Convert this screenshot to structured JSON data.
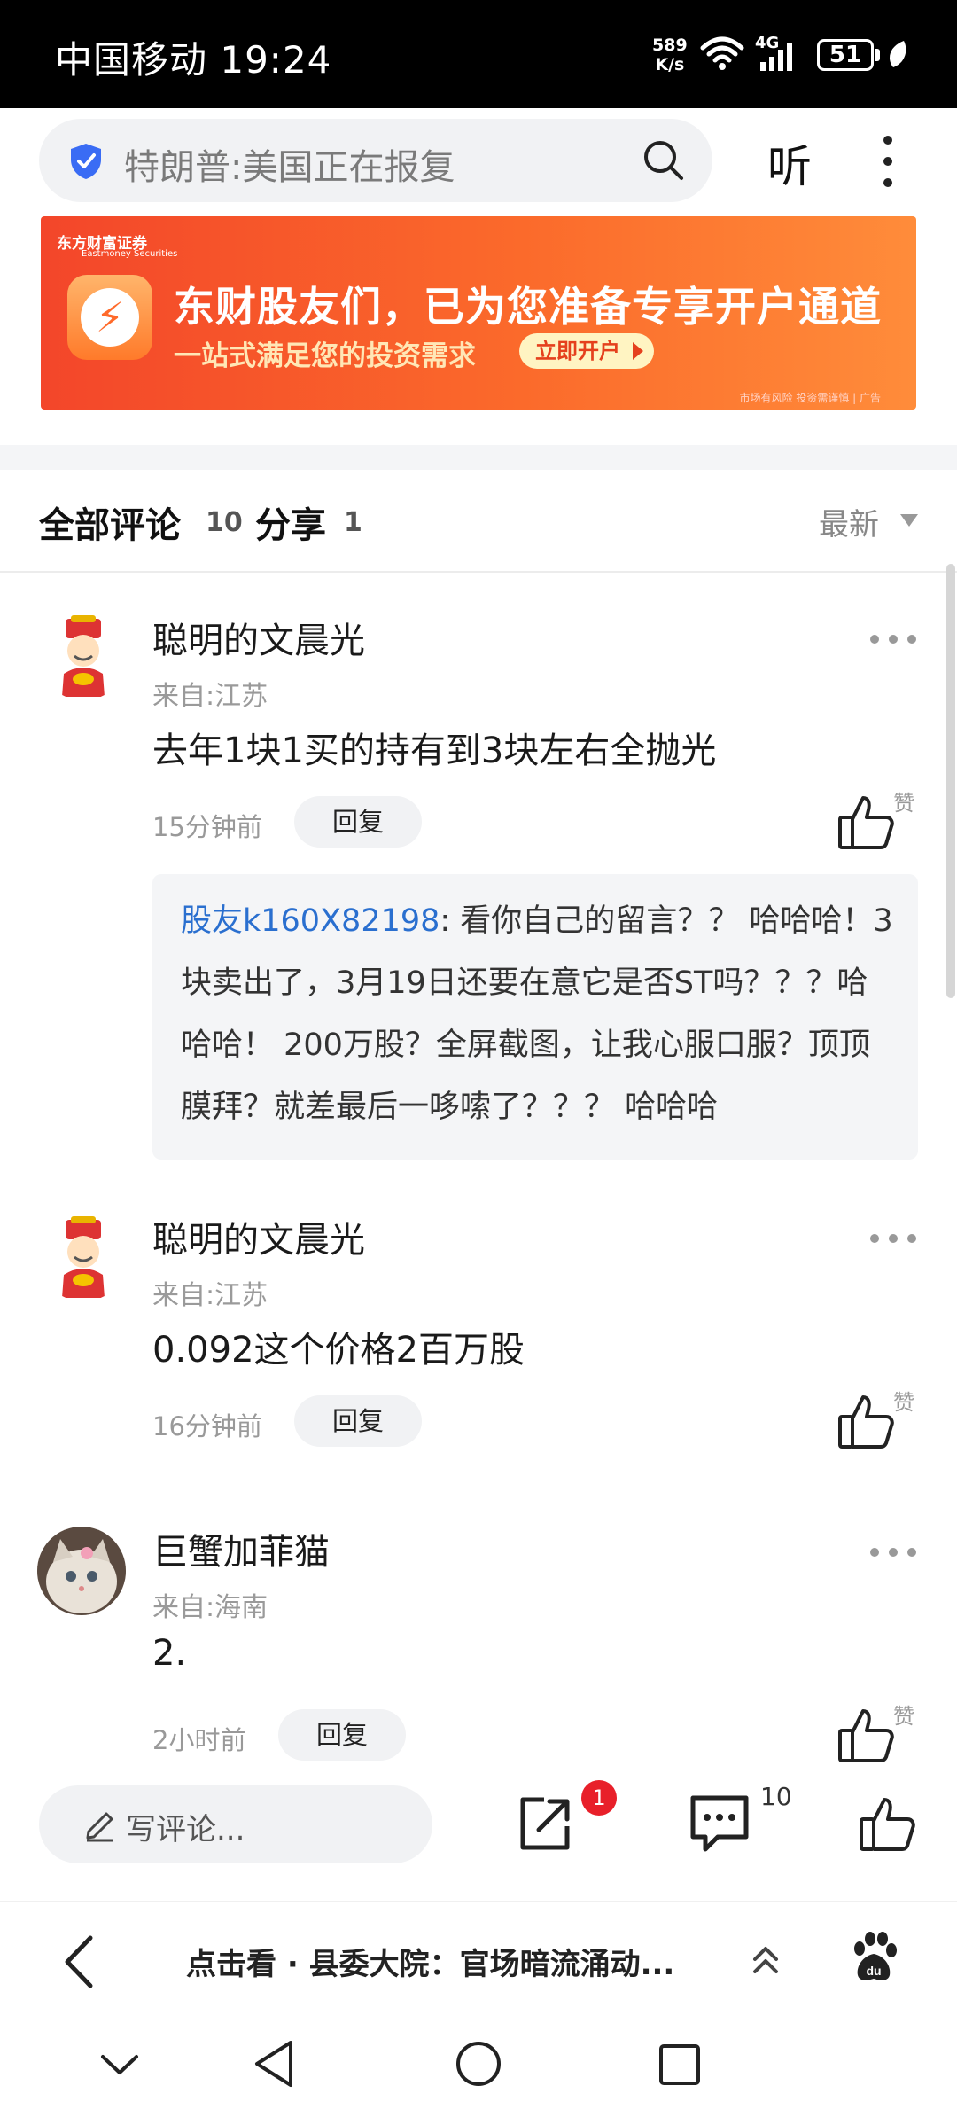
{
  "status_bar": {
    "carrier_time": "中国移动 19:24",
    "net_speed_value": "589",
    "net_speed_unit": "K/s",
    "network": "4G",
    "battery": "51"
  },
  "search": {
    "query": "特朗普:美国正在报复",
    "listen_label": "听"
  },
  "banner": {
    "brand": "东方财富证券",
    "brand_en": "Eastmoney Securities",
    "headline": "东财股友们，已为您准备专享开户通道",
    "subline": "一站式满足您的投资需求",
    "cta": "立即开户",
    "disclaimer": "市场有风险 投资需谨慎 | 广告",
    "colors": {
      "start": "#f3462a",
      "end": "#ff8c3a"
    }
  },
  "comments_header": {
    "all_label": "全部评论",
    "all_count": "10",
    "share_label": "分享",
    "share_count": "1",
    "sort_label": "最新"
  },
  "comments": [
    {
      "user": "聪明的文晨光",
      "location": "来自:江苏",
      "text": "去年1块1买的持有到3块左右全抛光",
      "time": "15分钟前",
      "reply_label": "回复",
      "like_label": "赞",
      "reply": {
        "user": "股友k160X82198",
        "text": ": 看你自己的留言？？ 哈哈哈！3块卖出了，3月19日还要在意它是否ST吗？？？哈哈哈！ 200万股？全屏截图，让我心服口服？顶顶膜拜？就差最后一哆嗦了？？？ 哈哈哈"
      }
    },
    {
      "user": "聪明的文晨光",
      "location": "来自:江苏",
      "text": "0.092这个价格2百万股",
      "time": "16分钟前",
      "reply_label": "回复",
      "like_label": "赞"
    },
    {
      "user": "巨蟹加菲猫",
      "location": "来自:海南",
      "text": "2.",
      "time": "2小时前",
      "reply_label": "回复",
      "like_label": "赞"
    }
  ],
  "action_bar": {
    "write_placeholder": "写评论...",
    "share_badge": "1",
    "comment_count": "10"
  },
  "recommend": {
    "text": "点击看 · 县委大院：官场暗流涌动..."
  }
}
